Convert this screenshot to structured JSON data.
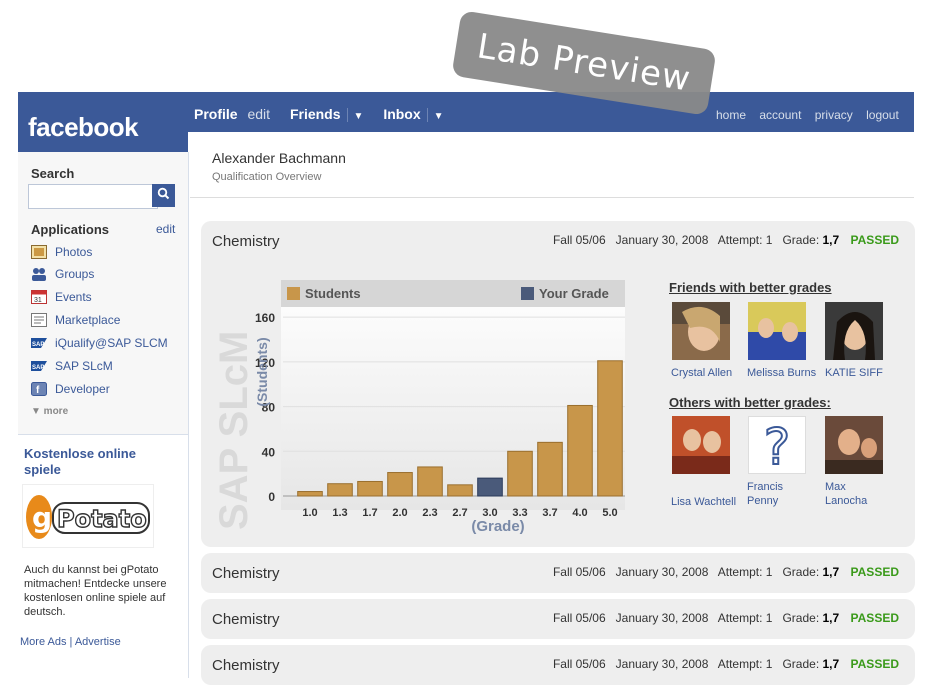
{
  "app": {
    "logo": "facebook",
    "brand_color": "#3b5998"
  },
  "stamp": "Lab Preview",
  "nav": {
    "profile": "Profile",
    "edit": "edit",
    "friends": "Friends",
    "inbox": "Inbox",
    "dropdown_arrow": "▼",
    "right": [
      "home",
      "account",
      "privacy",
      "logout"
    ]
  },
  "sidebar": {
    "search_label": "Search",
    "search_value": "",
    "search_icon": "magnifier-icon",
    "applications_label": "Applications",
    "applications_edit": "edit",
    "apps": [
      {
        "label": "Photos",
        "icon": "photos-icon"
      },
      {
        "label": "Groups",
        "icon": "groups-icon"
      },
      {
        "label": "Events",
        "icon": "events-icon"
      },
      {
        "label": "Marketplace",
        "icon": "marketplace-icon"
      },
      {
        "label": "iQualify@SAP SLCM",
        "icon": "sap-icon"
      },
      {
        "label": "SAP SLcM",
        "icon": "sap-icon"
      },
      {
        "label": "Developer",
        "icon": "developer-icon"
      }
    ],
    "more": "▼ more",
    "ad_title": "Kostenlose online spiele",
    "ad_logo": "gPotato",
    "ad_text": "Auch du kannst bei gPotato mitmachen! Entdecke unsere kostenlosen online spiele auf deutsch.",
    "ad_links": "More Ads | Advertise"
  },
  "header": {
    "name": "Alexander Bachmann",
    "subtitle": "Qualification Overview"
  },
  "courses": [
    {
      "name": "Chemistry",
      "term": "Fall 05/06",
      "date": "January 30, 2008",
      "attempt": "Attempt: 1",
      "grade_label": "Grade:",
      "grade": "1,7",
      "status": "PASSED"
    },
    {
      "name": "Chemistry",
      "term": "Fall 05/06",
      "date": "January 30, 2008",
      "attempt": "Attempt: 1",
      "grade_label": "Grade:",
      "grade": "1,7",
      "status": "PASSED"
    },
    {
      "name": "Chemistry",
      "term": "Fall 05/06",
      "date": "January 30, 2008",
      "attempt": "Attempt: 1",
      "grade_label": "Grade:",
      "grade": "1,7",
      "status": "PASSED"
    },
    {
      "name": "Chemistry",
      "term": "Fall 05/06",
      "date": "January 30, 2008",
      "attempt": "Attempt: 1",
      "grade_label": "Grade:",
      "grade": "1,7",
      "status": "PASSED"
    }
  ],
  "chart_data": {
    "type": "bar",
    "watermark": "SAP SLcM",
    "legend": [
      {
        "name": "Students",
        "color": "#c8964a"
      },
      {
        "name": "Your Grade",
        "color": "#4a5a7a"
      }
    ],
    "categories": [
      "1.0",
      "1.3",
      "1.7",
      "2.0",
      "2.3",
      "2.7",
      "3.0",
      "3.3",
      "3.7",
      "4.0",
      "5.0"
    ],
    "values": [
      4,
      11,
      13,
      21,
      26,
      10,
      16,
      40,
      48,
      81,
      121
    ],
    "highlight_index": 6,
    "yticks": [
      0,
      40,
      80,
      120,
      160
    ],
    "ylim": [
      0,
      170
    ],
    "xlabel": "(Grade)",
    "ylabel": "(Students)",
    "colors": {
      "bar": "#c8964a",
      "bar_stroke": "#9a6f2e",
      "highlight": "#4a5a7a"
    }
  },
  "friends": {
    "title": "Friends with better grades",
    "people": [
      {
        "name": "Crystal Allen"
      },
      {
        "name": "Melissa Burns"
      },
      {
        "name": "KATIE SIFF"
      }
    ]
  },
  "others": {
    "title": "Others with better grades:",
    "people": [
      {
        "name": "Lisa Wachtell"
      },
      {
        "name": "Francis Penny"
      },
      {
        "name": "Max Lanocha"
      }
    ]
  }
}
